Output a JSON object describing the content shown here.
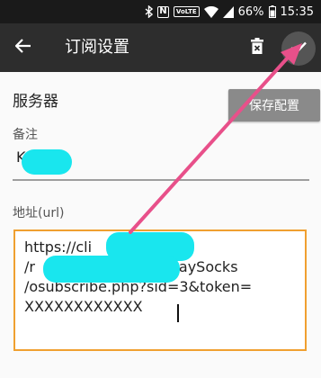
{
  "status_bar": {
    "battery_percent": "66%",
    "time": "15:35",
    "volte_label": "VoLTE",
    "nfc_label": "N",
    "icons": [
      "bluetooth-icon",
      "nfc-icon",
      "volte-icon",
      "wifi-icon",
      "signal-icon",
      "battery-icon"
    ]
  },
  "toolbar": {
    "title": "订阅设置",
    "back_icon": "arrow-left-icon",
    "delete_icon": "trash-icon",
    "confirm_icon": "checkmark-icon"
  },
  "form": {
    "section_title": "服务器",
    "save_config_label": "保存配置",
    "remark_label": "备注",
    "remark_value": "K",
    "url_label": "地址(url)",
    "url_lines": [
      "https://cli              com",
      "/r                          V2raySocks",
      "/osubscribe.php?sid=3&token=",
      "XXXXXXXXXXXX"
    ]
  },
  "colors": {
    "toolbar_bg": "#2d2d2d",
    "status_bg": "#1a1a1a",
    "field_border": "#f0a030",
    "button_bg": "#8a8a8a",
    "arrow": "#e8508a",
    "redaction": "#19e6ee"
  }
}
